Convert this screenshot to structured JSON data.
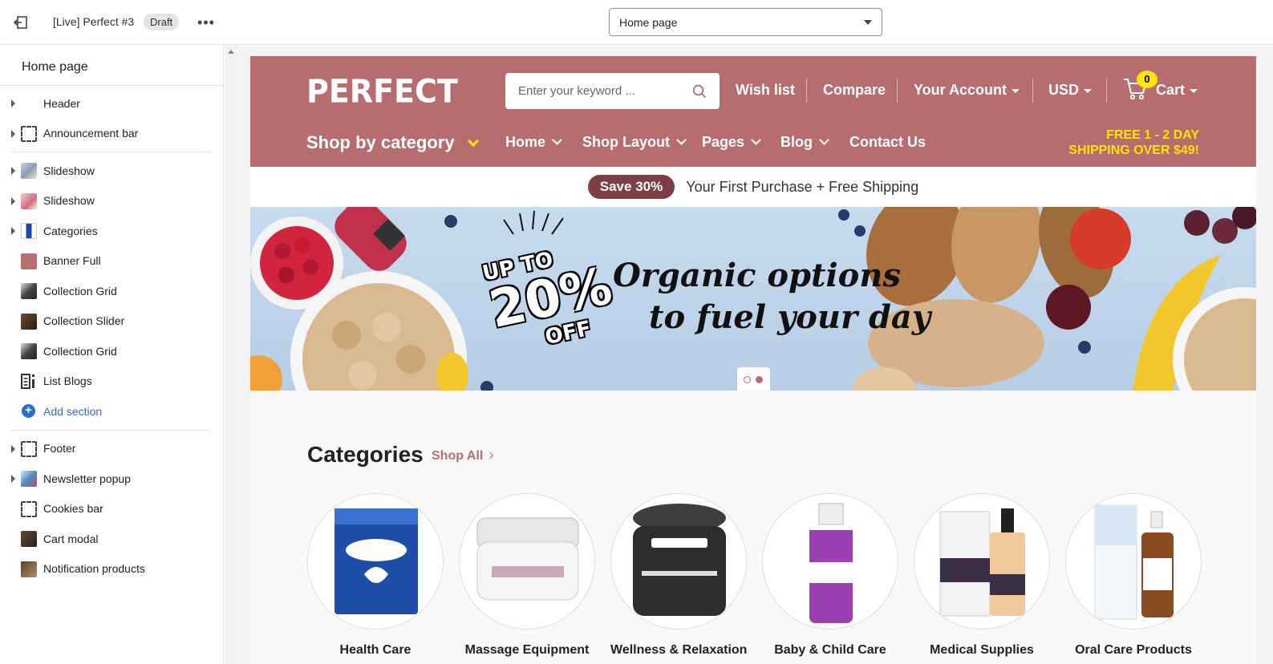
{
  "topbar": {
    "theme_name": "[Live] Perfect #3",
    "badge": "Draft",
    "more": "•••",
    "page_select": "Home page"
  },
  "sidebar": {
    "title": "Home page",
    "header_group": [
      {
        "label": "Header",
        "expandable": true,
        "icon": "none"
      },
      {
        "label": "Announcement bar",
        "expandable": true,
        "icon": "section-dashed-icon"
      }
    ],
    "template_group": [
      {
        "label": "Slideshow",
        "expandable": true,
        "icon": "slideshow-thumbnail-icon"
      },
      {
        "label": "Slideshow",
        "expandable": true,
        "icon": "slideshow-thumbnail-icon"
      },
      {
        "label": "Categories",
        "expandable": true,
        "icon": "categories-thumbnail-icon"
      },
      {
        "label": "Banner Full",
        "expandable": false,
        "icon": "banner-thumbnail-icon"
      },
      {
        "label": "Collection Grid",
        "expandable": false,
        "icon": "collection-thumbnail-icon"
      },
      {
        "label": "Collection Slider",
        "expandable": false,
        "icon": "collection-thumbnail-icon"
      },
      {
        "label": "Collection Grid",
        "expandable": false,
        "icon": "collection-thumbnail-icon"
      },
      {
        "label": "List Blogs",
        "expandable": false,
        "icon": "blog-list-icon"
      }
    ],
    "add_section": "Add section",
    "footer_group": [
      {
        "label": "Footer",
        "expandable": true,
        "icon": "section-dashed-icon"
      },
      {
        "label": "Newsletter popup",
        "expandable": true,
        "icon": "newsletter-thumbnail-icon"
      },
      {
        "label": "Cookies bar",
        "expandable": false,
        "icon": "section-dashed-icon"
      },
      {
        "label": "Cart modal",
        "expandable": false,
        "icon": "cart-thumbnail-icon"
      },
      {
        "label": "Notification products",
        "expandable": false,
        "icon": "notification-thumbnail-icon"
      }
    ]
  },
  "store": {
    "logo": "PERFECT",
    "search_placeholder": "Enter your keyword ...",
    "links": {
      "wishlist": "Wish list",
      "compare": "Compare",
      "account": "Your Account",
      "currency": "USD",
      "cart": "Cart",
      "cart_count": "0"
    },
    "shop_by_category": "Shop by category",
    "nav": [
      "Home",
      "Shop Layout",
      "Pages",
      "Blog",
      "Contact Us"
    ],
    "free_shipping": [
      "FREE 1 - 2 DAY",
      "SHIPPING OVER $49!"
    ],
    "announcement": {
      "pill": "Save 30%",
      "text": "Your First Purchase + Free Shipping"
    },
    "slide": {
      "promo_up": "UP TO",
      "promo_pct": "20%",
      "promo_off": "OFF",
      "title_line1": "Organic options",
      "title_line2": "to fuel your day"
    },
    "categories": {
      "title": "Categories",
      "shop_all": "Shop All",
      "items": [
        "Health Care",
        "Massage Equipment",
        "Wellness & Relaxation",
        "Baby & Child Care",
        "Medical Supplies",
        "Oral Care Products"
      ]
    }
  },
  "colors": {
    "header": "#b76d70",
    "accent_yellow": "#ffe600",
    "pill": "#7d3f43",
    "link_blue": "#2c6ecb"
  }
}
